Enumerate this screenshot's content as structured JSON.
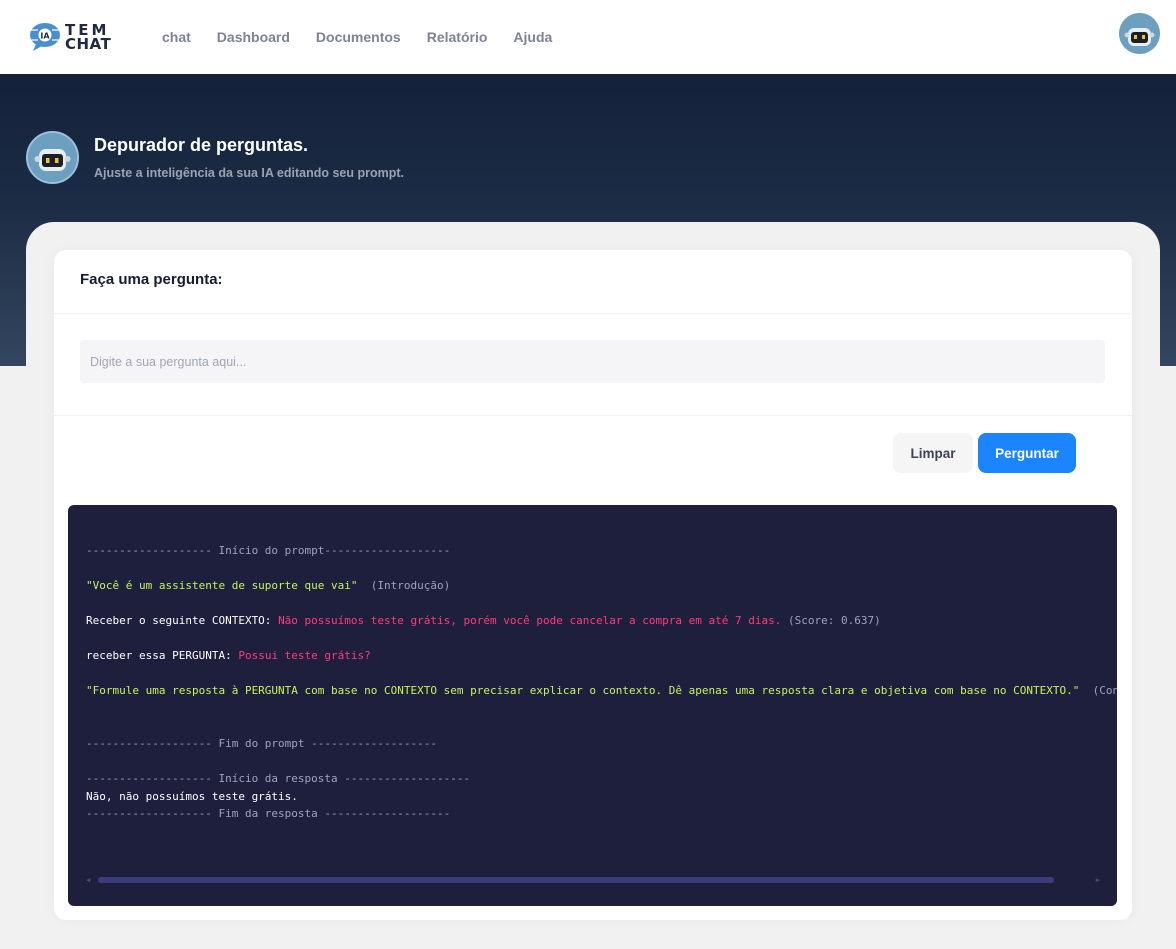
{
  "brand": {
    "line1": "TEM",
    "line2": "CHAT",
    "badge": "IA"
  },
  "nav": [
    "chat",
    "Dashboard",
    "Documentos",
    "Relatório",
    "Ajuda"
  ],
  "hero": {
    "title": "Depurador de perguntas.",
    "subtitle": "Ajuste a inteligência da sua IA editando seu prompt."
  },
  "form": {
    "title": "Faça uma pergunta:",
    "placeholder": "Digite a sua pergunta aqui...",
    "clear_label": "Limpar",
    "ask_label": "Perguntar"
  },
  "console": {
    "prompt_start": "------------------- Início do prompt-------------------",
    "intro_text": "\"Você é um assistente de suporte que vai\"",
    "intro_tag": "  (Introdução)",
    "context_label": "Receber o seguinte CONTEXTO: ",
    "context_text": "Não possuímos teste grátis, porém você pode cancelar a compra em até 7 dias.",
    "context_score": " (Score: 0.637)",
    "question_label": "receber essa PERGUNTA: ",
    "question_text": "Possui teste grátis?",
    "conclusion_text": "\"Formule uma resposta à PERGUNTA com base no CONTEXTO sem precisar explicar o contexto. Dê apenas uma resposta clara e objetiva com base no CONTEXTO.\"",
    "conclusion_tag": "  (Concl",
    "prompt_end": "------------------- Fim do prompt -------------------",
    "response_start": "------------------- Início da resposta -------------------",
    "response_text": "Não, não possuímos teste grátis.",
    "response_end": "------------------- Fim da resposta -------------------"
  },
  "colors": {
    "primary": "#1b84ff",
    "console_bg": "#1e1f3d",
    "green": "#c3f45c",
    "pink": "#ff3b7a"
  }
}
